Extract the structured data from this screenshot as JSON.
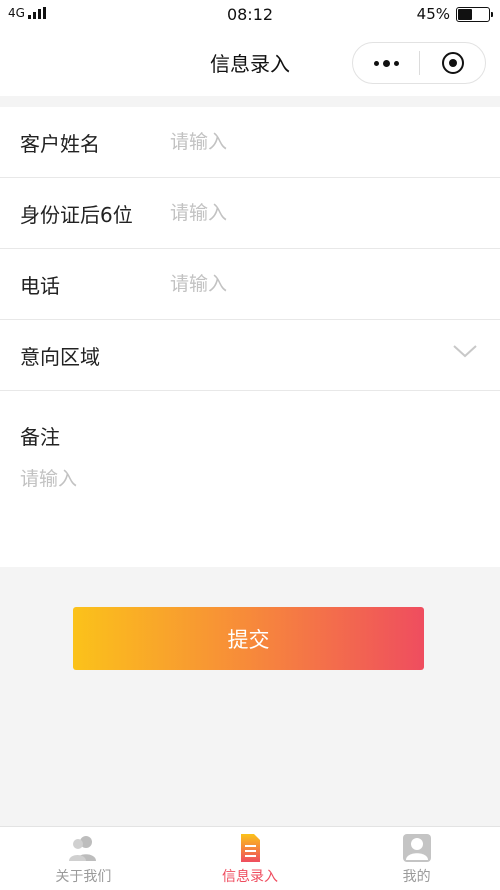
{
  "status_bar": {
    "network": "4G",
    "time": "08:12",
    "battery_percent": "45%",
    "battery_level": 0.45
  },
  "nav": {
    "title": "信息录入"
  },
  "form": {
    "fields": [
      {
        "label": "客户姓名",
        "placeholder": "请输入",
        "value": ""
      },
      {
        "label": "身份证后6位",
        "placeholder": "请输入",
        "value": ""
      },
      {
        "label": "电话",
        "placeholder": "请输入",
        "value": ""
      }
    ],
    "area": {
      "label": "意向区域",
      "value": ""
    },
    "remark": {
      "label": "备注",
      "placeholder": "请输入",
      "value": ""
    }
  },
  "submit_label": "提交",
  "tabs": [
    {
      "label": "关于我们",
      "icon": "users-icon",
      "active": false
    },
    {
      "label": "信息录入",
      "icon": "document-icon",
      "active": true
    },
    {
      "label": "我的",
      "icon": "user-icon",
      "active": false
    }
  ],
  "colors": {
    "accent": "#ef4d5f",
    "gradient_start": "#fbc21a",
    "gradient_end": "#ef4d5f",
    "tab_inactive": "#9a9a9a"
  }
}
